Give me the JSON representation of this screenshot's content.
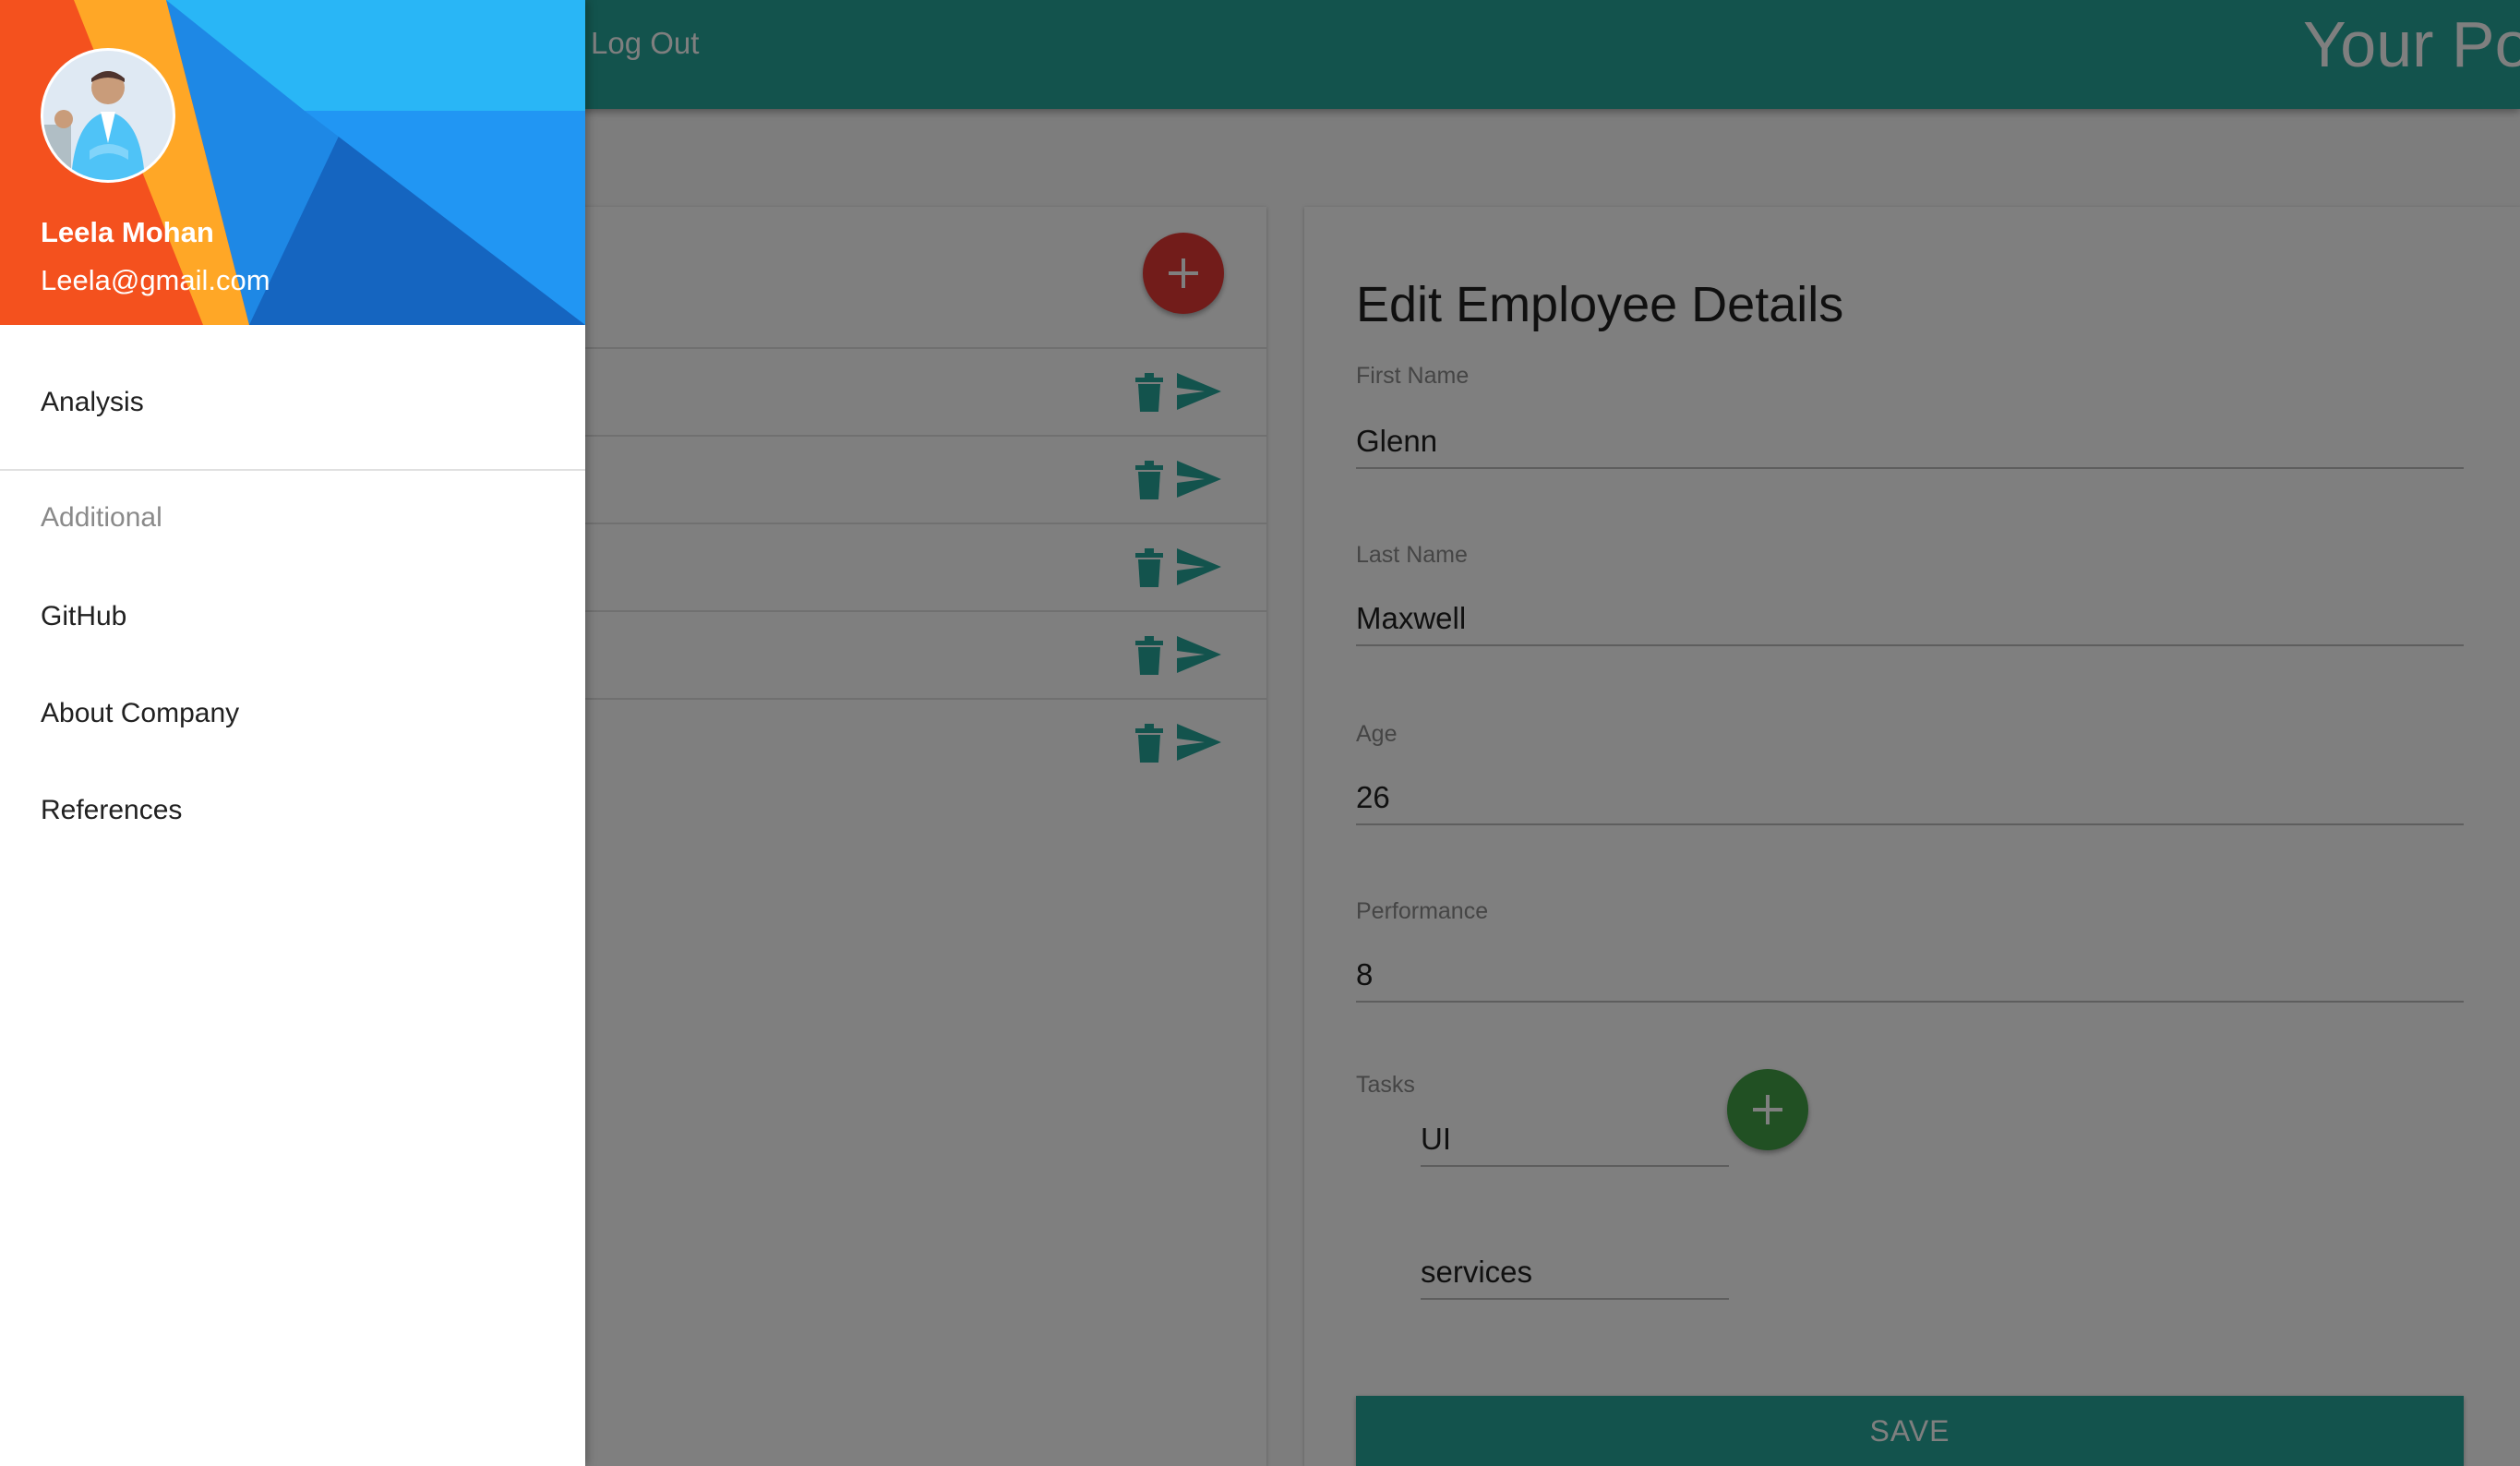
{
  "topbar": {
    "logout_label": "Log Out",
    "brand_title": "Your Po"
  },
  "employee_list": {
    "add_button_icon": "plus-icon",
    "row_count": 5,
    "row_actions": [
      "trash-icon",
      "send-icon"
    ]
  },
  "edit_form": {
    "title": "Edit Employee Details",
    "first_name": {
      "label": "First Name",
      "value": "Glenn"
    },
    "last_name": {
      "label": "Last Name",
      "value": "Maxwell"
    },
    "age": {
      "label": "Age",
      "value": "26"
    },
    "performance": {
      "label": "Performance",
      "value": "8"
    },
    "tasks": {
      "label": "Tasks",
      "items": [
        "UI",
        "services"
      ]
    },
    "save_label": "SAVE"
  },
  "drawer": {
    "user_name": "Leela Mohan",
    "user_email": "Leela@gmail.com",
    "items": [
      {
        "label": "Analysis"
      },
      {
        "label": "GitHub"
      },
      {
        "label": "About Company"
      },
      {
        "label": "References"
      }
    ],
    "subheader": "Additional"
  },
  "colors": {
    "primary": "#26a69a",
    "fab_red": "#e53935",
    "fab_green": "#43a047",
    "icon_teal": "#26a69a"
  }
}
